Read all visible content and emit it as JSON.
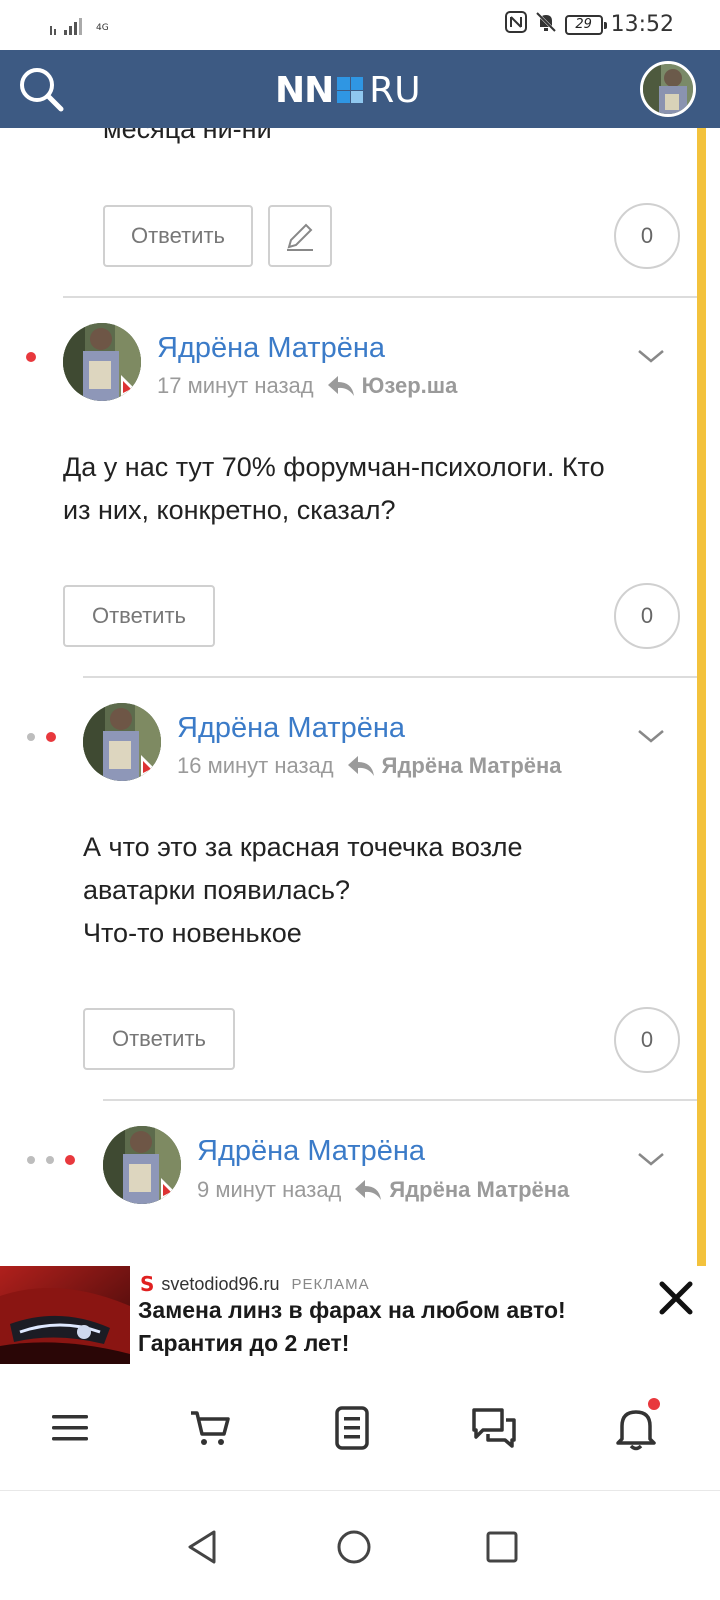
{
  "status_bar": {
    "network": "4G",
    "battery": "29",
    "time": "13:52"
  },
  "header": {
    "logo_left": "NN",
    "logo_right": "RU",
    "colors": {
      "background": "#3d5a83",
      "logo_square": "#2f96e3"
    }
  },
  "comments": {
    "previous": {
      "cut_text": "месяца ни-ни",
      "reply_label": "Ответить",
      "likes": "0"
    },
    "items": [
      {
        "author": "Ядрёна Матрёна",
        "time": "17 минут назад",
        "reply_to": "Юзер.ша",
        "text_lines": [
          "Да у нас тут 70% форумчан-психологи. Кто",
          "из них, конкретно, сказал?"
        ],
        "reply_label": "Ответить",
        "likes": "0"
      },
      {
        "author": "Ядрёна Матрёна",
        "time": "16 минут назад",
        "reply_to": "Ядрёна Матрёна",
        "text_lines": [
          "А что это за красная точечка возле",
          "аватарки появилась?",
          "Что-то новенькое"
        ],
        "reply_label": "Ответить",
        "likes": "0"
      },
      {
        "author": "Ядрёна Матрёна",
        "time": "9 минут назад",
        "reply_to": "Ядрёна Матрёна"
      }
    ]
  },
  "ad": {
    "source": "svetodiod96.ru",
    "label": "РЕКЛАМА",
    "title_line1": "Замена линз в фарах на любом авто!",
    "title_line2": "Гарантия до 2 лет!"
  },
  "colors": {
    "accent_link": "#3b7bc8",
    "unread_dot": "#e8383d",
    "scroll_indicator": "#f3c23c"
  }
}
